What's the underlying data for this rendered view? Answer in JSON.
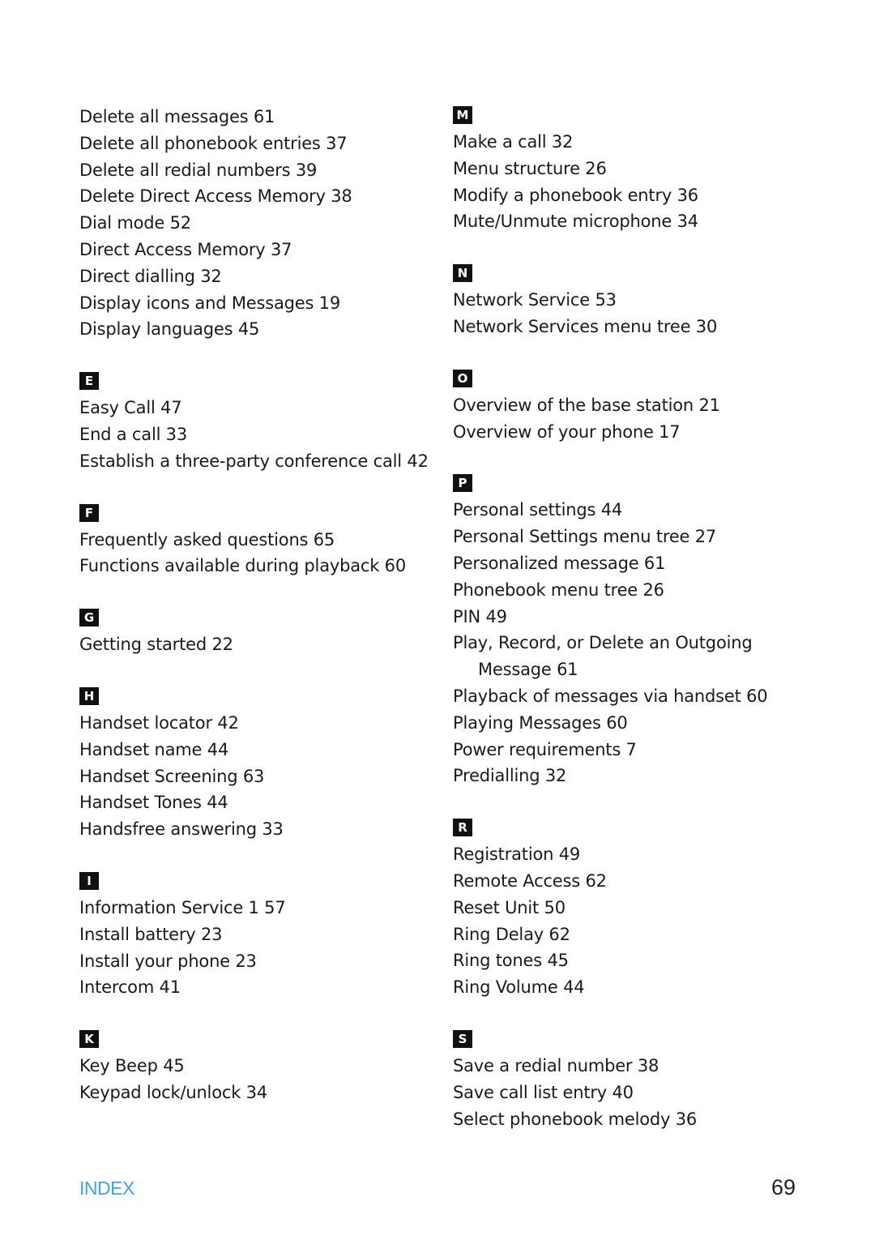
{
  "left_column": [
    {
      "letter": "",
      "entries": [
        "Delete all messages 61",
        "Delete all phonebook entries 37",
        "Delete all redial numbers 39",
        "Delete Direct Access Memory 38",
        "Dial mode 52",
        "Direct Access Memory 37",
        "Direct dialling 32",
        "Display icons and Messages 19",
        "Display languages 45"
      ]
    },
    {
      "letter": "E",
      "entries": [
        "Easy Call 47",
        "End a call 33",
        "Establish a three-party conference call 42"
      ]
    },
    {
      "letter": "F",
      "entries": [
        "Frequently asked questions 65",
        "Functions available during playback 60"
      ]
    },
    {
      "letter": "G",
      "entries": [
        "Getting started 22"
      ]
    },
    {
      "letter": "H",
      "entries": [
        "Handset locator 42",
        "Handset name 44",
        "Handset Screening 63",
        "Handset Tones 44",
        "Handsfree answering 33"
      ]
    },
    {
      "letter": "I",
      "entries": [
        "Information Service 1 57",
        "Install battery 23",
        "Install your phone 23",
        "Intercom 41"
      ]
    },
    {
      "letter": "K",
      "entries": [
        "Key Beep 45",
        "Keypad lock/unlock 34"
      ]
    }
  ],
  "right_column": [
    {
      "letter": "M",
      "entries": [
        "Make a call 32",
        "Menu structure 26",
        "Modify a phonebook entry 36",
        "Mute/Unmute microphone 34"
      ]
    },
    {
      "letter": "N",
      "entries": [
        "Network Service 53",
        "Network Services menu tree 30"
      ]
    },
    {
      "letter": "O",
      "entries": [
        "Overview of the base station 21",
        "Overview of your phone 17"
      ]
    },
    {
      "letter": "P",
      "entries": [
        "Personal settings 44",
        "Personal Settings menu tree 27",
        "Personalized message 61",
        "Phonebook menu tree 26",
        "PIN 49",
        "Play, Record, or Delete an Outgoing",
        "Message 61",
        "Playback of messages via handset 60",
        "Playing Messages 60",
        "Power requirements 7",
        "Predialling 32"
      ]
    },
    {
      "letter": "R",
      "entries": [
        "Registration 49",
        "Remote Access 62",
        "Reset Unit 50",
        "Ring Delay 62",
        "Ring tones 45",
        "Ring Volume 44"
      ]
    },
    {
      "letter": "S",
      "entries": [
        "Save a redial number 38",
        "Save call list entry 40",
        "Select phonebook melody 36"
      ]
    }
  ],
  "footer": {
    "section_label": "INDEX",
    "page_number": "69",
    "accent_color": "#3ea6d8"
  }
}
